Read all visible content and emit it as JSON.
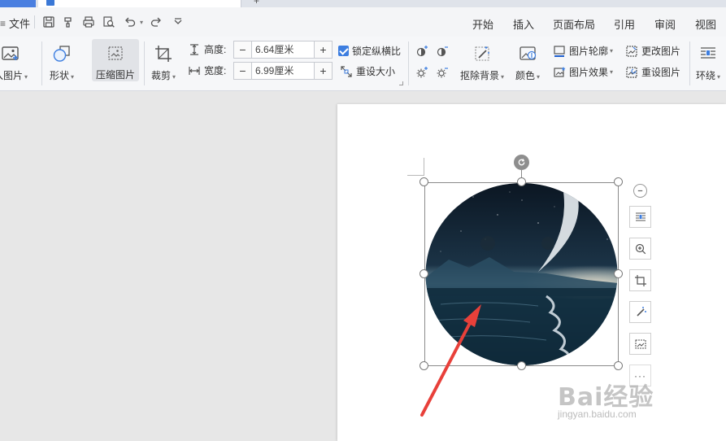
{
  "tabs": {
    "home_label": "",
    "doc_label": ""
  },
  "menubar": {
    "file_label": "文件",
    "tabs": [
      "开始",
      "插入",
      "页面布局",
      "引用",
      "审阅",
      "视图"
    ]
  },
  "ribbon": {
    "insert_picture_label": "入图片",
    "shape_label": "形状",
    "compress_label": "压缩图片",
    "crop_label": "裁剪",
    "height_label": "高度:",
    "height_value": "6.64厘米",
    "width_label": "宽度:",
    "width_value": "6.99厘米",
    "lock_ratio_label": "锁定纵横比",
    "lock_ratio_checked": true,
    "reset_size_label": "重设大小",
    "remove_bg_label": "抠除背景",
    "color_label": "颜色",
    "outline_label": "图片轮廓",
    "effect_label": "图片效果",
    "change_picture_label": "更改图片",
    "reset_picture_label": "重设图片",
    "wrap_label": "环绕"
  },
  "side_tools": {
    "more_label": "···"
  },
  "watermark": {
    "main": "Bai经验",
    "sub": "jingyan.baidu.com"
  },
  "colors": {
    "accent": "#3d7ee0",
    "arrow": "#e8403a",
    "page": "#ffffff",
    "workspace": "#e7e7e7"
  }
}
